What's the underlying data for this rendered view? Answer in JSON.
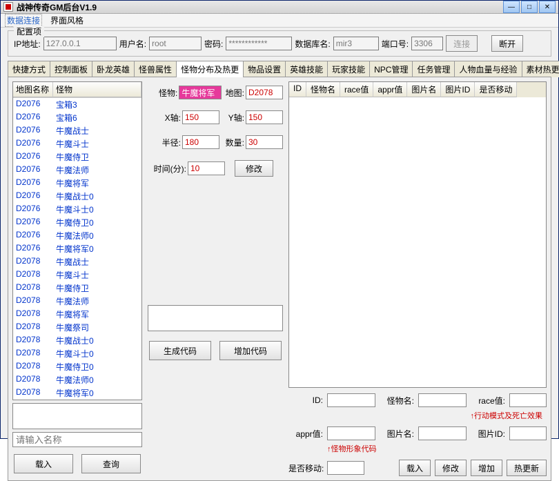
{
  "title": "战神传奇GM后台V1.9",
  "menu": {
    "item1": "数据连接",
    "item2": "界面风格"
  },
  "config": {
    "legend": "配置项",
    "ip_label": "IP地址:",
    "ip": "127.0.0.1",
    "user_label": "用户名:",
    "user": "root",
    "pwd_label": "密码:",
    "pwd": "************",
    "db_label": "数据库名:",
    "db": "mir3",
    "port_label": "端口号:",
    "port": "3306",
    "connect": "连接",
    "disconnect": "断开"
  },
  "tabs": [
    "快捷方式",
    "控制面板",
    "卧龙英雄",
    "怪兽属性",
    "怪物分布及热更",
    "物品设置",
    "英雄技能",
    "玩家技能",
    "NPC管理",
    "任务管理",
    "人物血量与经验",
    "素材热更"
  ],
  "active_tab": 4,
  "list": {
    "h1": "地图名称",
    "h2": "怪物",
    "rows": [
      [
        "D2076",
        "宝箱3"
      ],
      [
        "D2076",
        "宝箱6"
      ],
      [
        "D2076",
        "牛魔战士"
      ],
      [
        "D2076",
        "牛魔斗士"
      ],
      [
        "D2076",
        "牛魔侍卫"
      ],
      [
        "D2076",
        "牛魔法师"
      ],
      [
        "D2076",
        "牛魔将军"
      ],
      [
        "D2076",
        "牛魔战士0"
      ],
      [
        "D2076",
        "牛魔斗士0"
      ],
      [
        "D2076",
        "牛魔侍卫0"
      ],
      [
        "D2076",
        "牛魔法师0"
      ],
      [
        "D2076",
        "牛魔将军0"
      ],
      [
        "D2078",
        "牛魔战士"
      ],
      [
        "D2078",
        "牛魔斗士"
      ],
      [
        "D2078",
        "牛魔侍卫"
      ],
      [
        "D2078",
        "牛魔法师"
      ],
      [
        "D2078",
        "牛魔将军"
      ],
      [
        "D2078",
        "牛魔祭司"
      ],
      [
        "D2078",
        "牛魔战士0"
      ],
      [
        "D2078",
        "牛魔斗士0"
      ],
      [
        "D2078",
        "牛魔侍卫0"
      ],
      [
        "D2078",
        "牛魔法师0"
      ],
      [
        "D2078",
        "牛魔将军0"
      ]
    ],
    "name_placeholder": "请输入名称"
  },
  "form": {
    "mon_label": "怪物:",
    "mon": "牛魔将军",
    "map_label": "地图:",
    "map": "D2078",
    "x_label": "X轴:",
    "x": "150",
    "y_label": "Y轴:",
    "y": "150",
    "r_label": "半径:",
    "r": "180",
    "n_label": "数量:",
    "n": "30",
    "t_label": "时间(分):",
    "t": "10",
    "modify": "修改"
  },
  "grid_head": [
    "ID",
    "怪物名",
    "race值",
    "appr值",
    "图片名",
    "图片ID",
    "是否移动"
  ],
  "detail": {
    "id_label": "ID:",
    "name_label": "怪物名:",
    "race_label": "race值:",
    "appr_label": "appr值:",
    "pic_label": "图片名:",
    "picid_label": "图片ID:",
    "move_label": "是否移动:",
    "hint1": "↑行动模式及死亡效果",
    "hint2": "↑怪物形象代码"
  },
  "buttons": {
    "load": "载入",
    "query": "查询",
    "gencode": "生成代码",
    "addcode": "增加代码",
    "load2": "载入",
    "modify2": "修改",
    "add": "增加",
    "hotupdate": "热更新"
  }
}
